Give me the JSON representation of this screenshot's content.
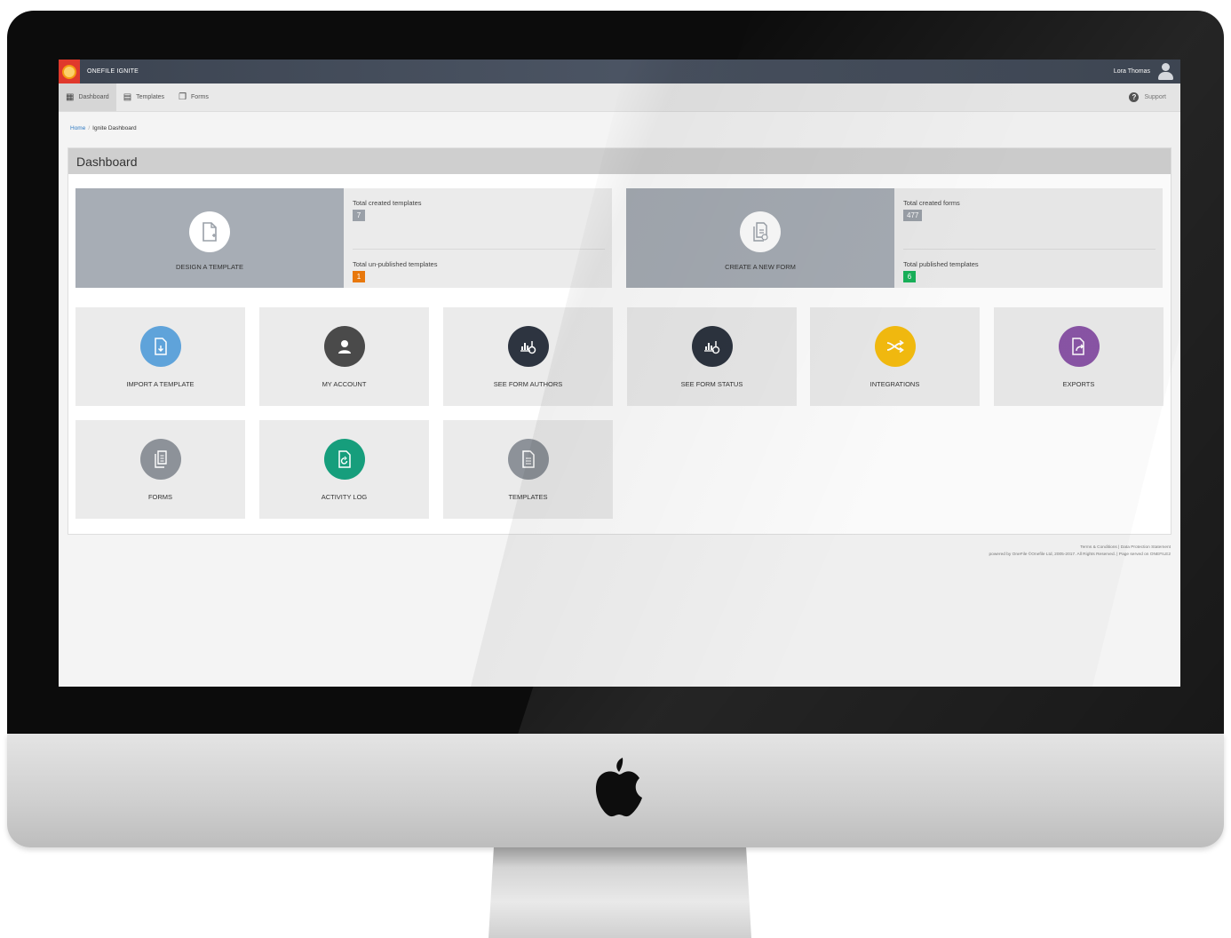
{
  "topbar": {
    "app_title": "ONEFILE IGNITE",
    "user_name": "Lora Thomas"
  },
  "nav": {
    "items": [
      {
        "label": "Dashboard",
        "icon": "grid-icon",
        "active": true
      },
      {
        "label": "Templates",
        "icon": "document-icon",
        "active": false
      },
      {
        "label": "Forms",
        "icon": "forms-icon",
        "active": false
      }
    ],
    "support_label": "Support"
  },
  "breadcrumb": {
    "home": "Home",
    "current": "Ignite Dashboard"
  },
  "panel": {
    "title": "Dashboard"
  },
  "cards": {
    "design": {
      "action_label": "DESIGN A TEMPLATE",
      "stats": [
        {
          "label": "Total created templates",
          "value": "7",
          "color": "#9aa0a8"
        },
        {
          "label": "Total un-published templates",
          "value": "1",
          "color": "#e8780c"
        }
      ]
    },
    "form": {
      "action_label": "CREATE A NEW FORM",
      "stats": [
        {
          "label": "Total created forms",
          "value": "477",
          "color": "#9aa0a8"
        },
        {
          "label": "Total published templates",
          "value": "6",
          "color": "#19b35a"
        }
      ]
    }
  },
  "tiles": [
    {
      "label": "IMPORT A TEMPLATE",
      "icon": "import-icon",
      "color": "#5fa3da"
    },
    {
      "label": "MY ACCOUNT",
      "icon": "user-icon",
      "color": "#4a4a4a"
    },
    {
      "label": "SEE FORM AUTHORS",
      "icon": "chart-icon",
      "color": "#2d3440"
    },
    {
      "label": "SEE FORM STATUS",
      "icon": "chart-icon",
      "color": "#2d3440"
    },
    {
      "label": "INTEGRATIONS",
      "icon": "shuffle-icon",
      "color": "#f6bd0f"
    },
    {
      "label": "EXPORTS",
      "icon": "export-icon",
      "color": "#8a55a6"
    },
    {
      "label": "FORMS",
      "icon": "forms-icon",
      "color": "#8d9299"
    },
    {
      "label": "ACTIVITY LOG",
      "icon": "activity-icon",
      "color": "#169e7c"
    },
    {
      "label": "TEMPLATES",
      "icon": "document-icon",
      "color": "#8d9299"
    }
  ],
  "footer": {
    "links": "Terms & Conditions | Data Protection Statement",
    "copyright": "powered by OneFile ©Onefile Ltd, 2005-2017. All Rights Reserved. | Page served on ONEFILE2"
  }
}
